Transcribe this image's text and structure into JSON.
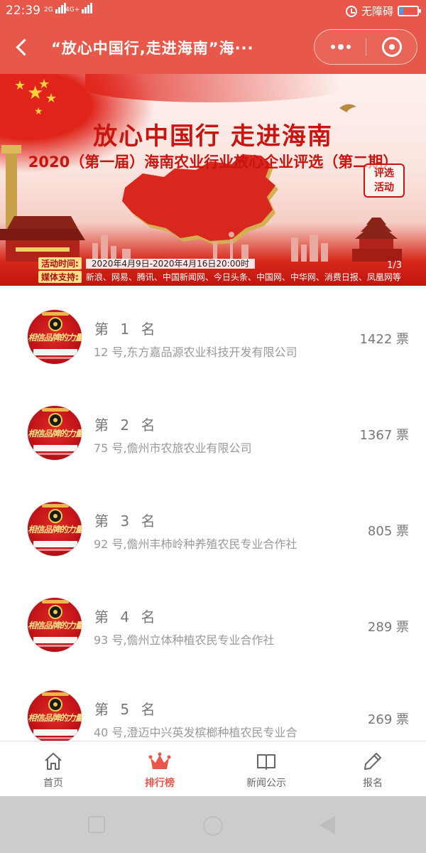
{
  "status_bar": {
    "time": "22:39",
    "signal1": "2G",
    "signal2": "4G+",
    "status_text": "无障碍",
    "icons": [
      "signal-icon",
      "alarm-icon",
      "battery-icon"
    ]
  },
  "nav": {
    "title": "“放心中国行,走进海南”海···",
    "icons": [
      "back-icon",
      "more-icon",
      "close-icon"
    ]
  },
  "banner": {
    "title": "放心中国行  走进海南",
    "subtitle": "2020（第一届）海南农业行业放心企业评选（第二期）",
    "stamp_line1": "评选",
    "stamp_line2": "活动",
    "time_label": "活动时间:",
    "time_value": "2020年4月9日-2020年4月16日20:00时",
    "media_label": "媒体支持:",
    "media_value": "新浪、网易、腾讯、中国新闻网、今日头条、中国网、中华网、消费日报、凤凰网等",
    "pager": "1/3"
  },
  "ranking": {
    "items": [
      {
        "rank": "第 1 名",
        "name": "12 号,东方嘉品源农业科技开发有限公司",
        "votes": "1422 票"
      },
      {
        "rank": "第 2 名",
        "name": "75 号,儋州市农旅农业有限公司",
        "votes": "1367 票"
      },
      {
        "rank": "第 3 名",
        "name": "92 号,儋州丰柿岭种养殖农民专业合作社",
        "votes": "805 票"
      },
      {
        "rank": "第 4 名",
        "name": "93 号,儋州立体种植农民专业合作社",
        "votes": "289 票"
      },
      {
        "rank": "第 5 名",
        "name": "40 号,澄迈中兴英发槟榔种植农民专业合",
        "votes": "269 票"
      }
    ],
    "logo_slogan": "相信品牌的力量"
  },
  "tabs": [
    {
      "label": "首页",
      "icon": "home-icon",
      "active": false
    },
    {
      "label": "排行榜",
      "icon": "crown-icon",
      "active": true
    },
    {
      "label": "新闻公示",
      "icon": "book-icon",
      "active": false
    },
    {
      "label": "报名",
      "icon": "pencil-icon",
      "active": false
    }
  ],
  "colors": {
    "primary": "#e8584a",
    "banner_red": "#c8150f",
    "gold": "#f2c94c",
    "text_muted": "#999999"
  }
}
